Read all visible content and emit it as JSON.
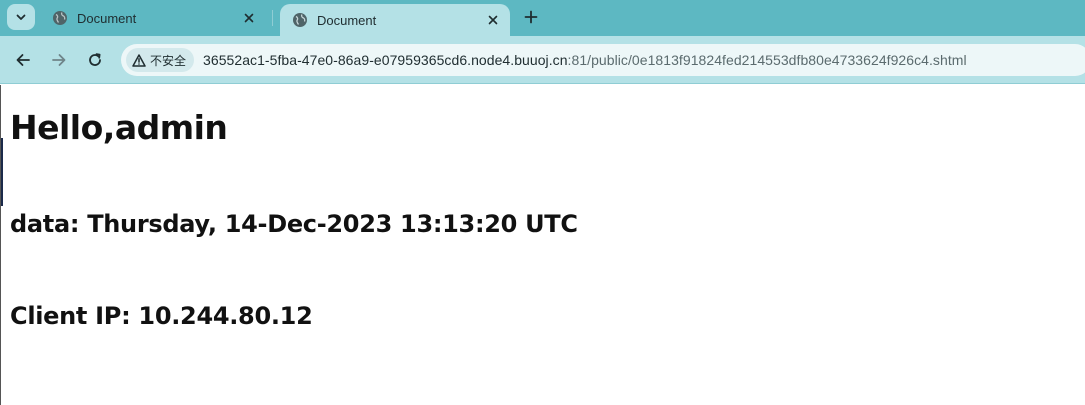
{
  "browser": {
    "tabs": [
      {
        "title": "Document",
        "active": false
      },
      {
        "title": "Document",
        "active": true
      }
    ],
    "security_label": "不安全",
    "url_host": "36552ac1-5fba-47e0-86a9-e07959365cd6.node4.buuoj.cn",
    "url_rest": ":81/public/0e1813f91824fed214553dfb80e4733624f926c4.shtml",
    "colors": {
      "tabstrip": "#5db8c2",
      "toolbar": "#b4e1e6"
    }
  },
  "page": {
    "greeting": "Hello,admin",
    "date_line": "data: Thursday, 14-Dec-2023 13:13:20 UTC",
    "ip_line": "Client IP: 10.244.80.12"
  }
}
